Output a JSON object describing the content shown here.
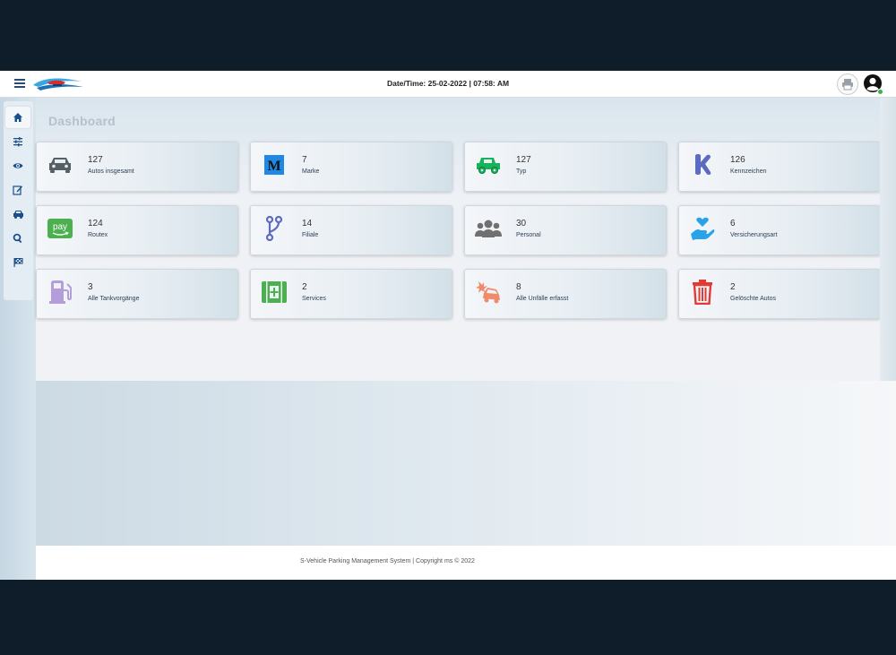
{
  "header": {
    "datetime": "Date/Time: 25-02-2022 | 07:58: AM"
  },
  "sidebar": {
    "items": [
      {
        "icon": "home-icon",
        "active": true
      },
      {
        "icon": "sliders-icon",
        "active": false
      },
      {
        "icon": "eye-icon",
        "active": false
      },
      {
        "icon": "edit-icon",
        "active": false
      },
      {
        "icon": "car-icon",
        "active": false
      },
      {
        "icon": "search-icon",
        "active": false
      },
      {
        "icon": "flag-icon",
        "active": false
      }
    ]
  },
  "main": {
    "title": "Dashboard",
    "cards": [
      {
        "count": "127",
        "label": "Autos insgesamt",
        "icon": "car-icon",
        "color": "#555f66"
      },
      {
        "count": "7",
        "label": "Marke",
        "icon": "medium-m-icon",
        "color": "#1e88e5"
      },
      {
        "count": "127",
        "label": "Typ",
        "icon": "truck-icon",
        "color": "#17b35a"
      },
      {
        "count": "126",
        "label": "Kennzeichen",
        "icon": "k-letter-icon",
        "color": "#5c6bc0"
      },
      {
        "count": "124",
        "label": "Routex",
        "icon": "amazon-pay-icon",
        "color": "#4caf50"
      },
      {
        "count": "14",
        "label": "Filiale",
        "icon": "branch-icon",
        "color": "#5c6bc0"
      },
      {
        "count": "30",
        "label": "Personal",
        "icon": "users-icon",
        "color": "#707070"
      },
      {
        "count": "6",
        "label": "Versicherungsart",
        "icon": "hand-heart-icon",
        "color": "#29a3e8"
      },
      {
        "count": "3",
        "label": "Alle Tankvorgänge",
        "icon": "gas-pump-icon",
        "color": "#b39ddb"
      },
      {
        "count": "2",
        "label": "Services",
        "icon": "medkit-icon",
        "color": "#4caf50"
      },
      {
        "count": "8",
        "label": "Alle Unfälle erfasst",
        "icon": "car-crash-icon",
        "color": "#f08a6c"
      },
      {
        "count": "2",
        "label": "Gelöschte Autos",
        "icon": "trash-icon",
        "color": "#e53935"
      }
    ]
  },
  "footer": {
    "text": "S-Vehicle Parking Management System  |  Copyright ms © 2022"
  }
}
